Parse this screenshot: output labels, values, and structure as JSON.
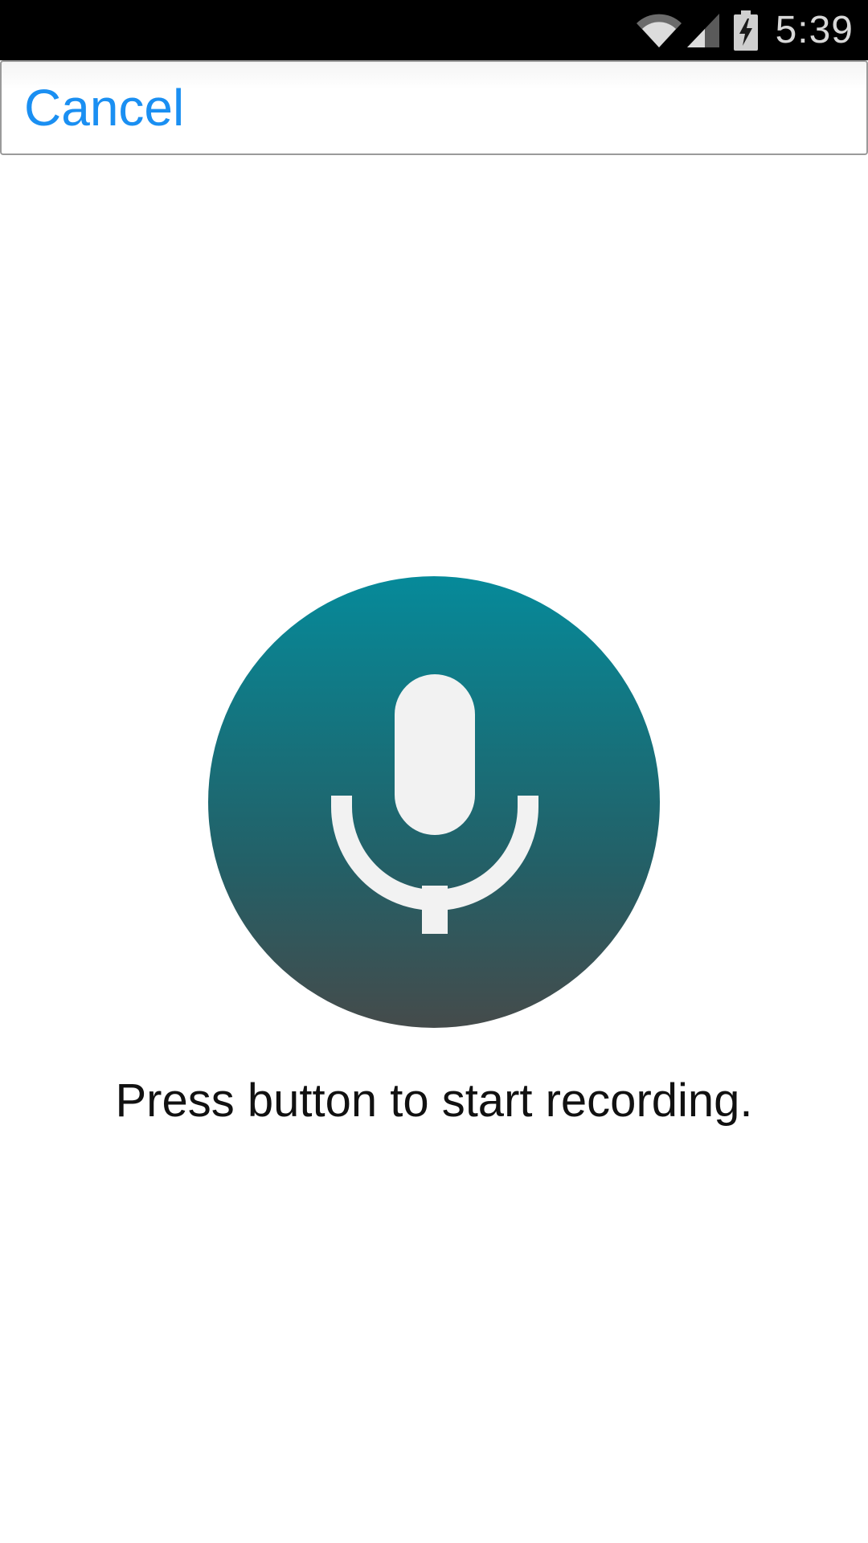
{
  "status_bar": {
    "time": "5:39",
    "icons": [
      "wifi-icon",
      "cell-signal-icon",
      "battery-charging-icon"
    ]
  },
  "header": {
    "cancel_label": "Cancel"
  },
  "main": {
    "mic_button_icon": "microphone-icon",
    "prompt": "Press button to start recording."
  },
  "colors": {
    "accent": "#1a8ff2",
    "mic_top": "#068a9a",
    "mic_bottom": "#454b4b"
  }
}
